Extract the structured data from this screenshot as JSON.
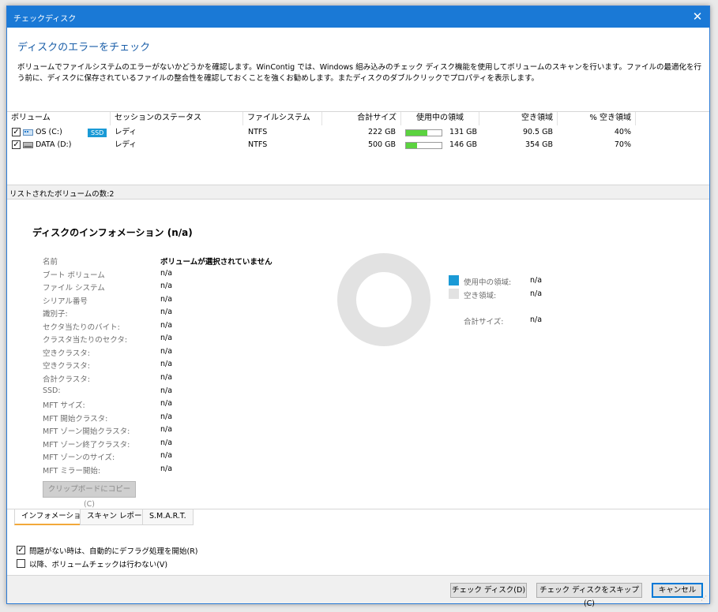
{
  "window": {
    "title": "チェックディスク",
    "close_glyph": "✕"
  },
  "header": {
    "heading": "ディスクのエラーをチェック",
    "description": "ボリュームでファイルシステムのエラーがないかどうかを確認します。WinContig では、Windows 組み込みのチェック ディスク機能を使用してボリュームのスキャンを行います。ファイルの最適化を行う前に、ディスクに保存されているファイルの整合性を確認しておくことを強くお勧めします。またディスクのダブルクリックでプロパティを表示します。"
  },
  "table": {
    "columns": [
      "ボリューム",
      "セッションのステータス",
      "ファイルシステム",
      "合計サイズ",
      "使用中の領域",
      "空き領域",
      "% 空き領域"
    ],
    "rows": [
      {
        "checked": true,
        "volume": "OS (C:)",
        "icon": "ssd-drive-icon",
        "badge": "SSD",
        "status": "レディ",
        "fs": "NTFS",
        "total": "222 GB",
        "used": "131 GB",
        "used_fraction": 0.6,
        "free": "90.5 GB",
        "free_pct": "40%"
      },
      {
        "checked": true,
        "volume": "DATA (D:)",
        "icon": "hdd-drive-icon",
        "badge": "",
        "status": "レディ",
        "fs": "NTFS",
        "total": "500 GB",
        "used": "146 GB",
        "used_fraction": 0.3,
        "free": "354 GB",
        "free_pct": "70%"
      }
    ]
  },
  "status": {
    "listed_count": "リストされたボリュームの数:2"
  },
  "info": {
    "title": "ディスクのインフォメーション (n/a)",
    "fields": [
      {
        "label": "名前",
        "value": "ボリュームが選択されていません"
      },
      {
        "label": "ブート ボリューム",
        "value": "n/a"
      },
      {
        "label": "ファイル システム",
        "value": "n/a"
      },
      {
        "label": "シリアル番号",
        "value": "n/a"
      },
      {
        "label": "識別子:",
        "value": "n/a"
      },
      {
        "label": "セクタ当たりのバイト:",
        "value": "n/a"
      },
      {
        "label": "クラスタ当たりのセクタ:",
        "value": "n/a"
      },
      {
        "label": "空きクラスタ:",
        "value": "n/a"
      },
      {
        "label": "空きクラスタ:",
        "value": "n/a"
      },
      {
        "label": "合計クラスタ:",
        "value": "n/a"
      },
      {
        "label": "SSD:",
        "value": "n/a"
      },
      {
        "label": "MFT サイズ:",
        "value": "n/a"
      },
      {
        "label": "MFT 開始クラスタ:",
        "value": "n/a"
      },
      {
        "label": "MFT ゾーン開始クラスタ:",
        "value": "n/a"
      },
      {
        "label": "MFT ゾーン終了クラスタ:",
        "value": "n/a"
      },
      {
        "label": "MFT ゾーンのサイズ:",
        "value": "n/a"
      },
      {
        "label": "MFT ミラー開始:",
        "value": "n/a"
      }
    ],
    "copy_button": "クリップボードにコピー(C)",
    "legend": {
      "used_label": "使用中の領域:",
      "used_value": "n/a",
      "used_color": "#1a9ad6",
      "free_label": "空き領域:",
      "free_value": "n/a",
      "free_color": "#e2e2e2",
      "total_label": "合計サイズ:",
      "total_value": "n/a"
    }
  },
  "tabs": [
    "インフォメーション",
    "スキャン レポート",
    "S.M.A.R.T."
  ],
  "options": [
    {
      "checked": true,
      "label": "問題がない時は、自動的にデフラグ処理を開始(R)"
    },
    {
      "checked": false,
      "label": "以降、ボリュームチェックは行わない(V)"
    }
  ],
  "buttons": {
    "check": "チェック ディスク(D)",
    "skip": "チェック ディスクをスキップ(C)",
    "cancel": "キャンセル"
  },
  "colors": {
    "titlebar": "#1a79d6",
    "heading": "#1a5ea8",
    "bar": "#5bd33f",
    "accent": "#1a9ad6"
  }
}
